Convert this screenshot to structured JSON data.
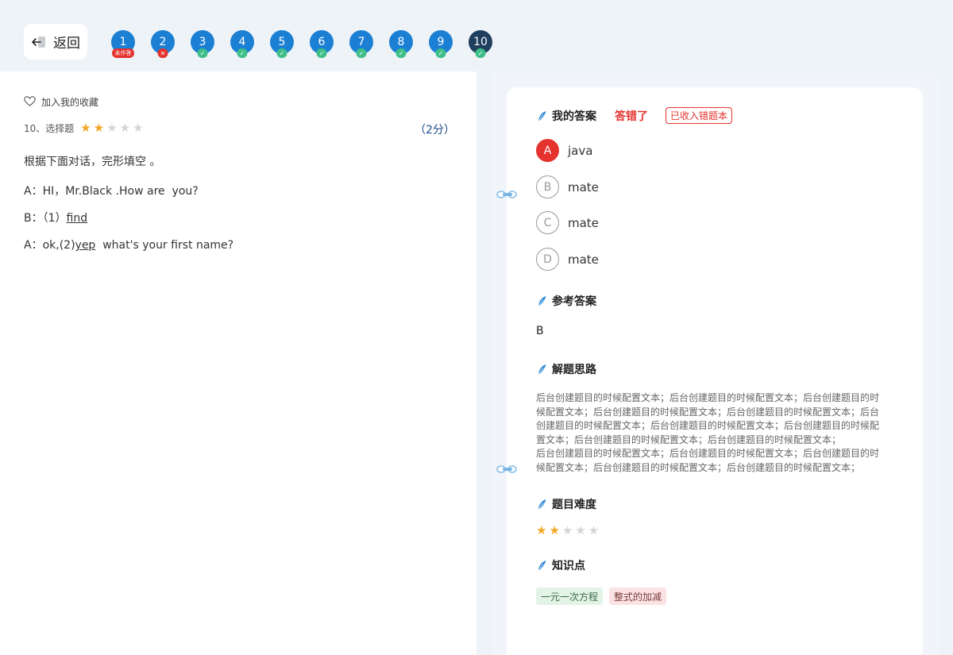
{
  "header": {
    "back_label": "返回",
    "questions": [
      {
        "num": "1",
        "badge": "未作答",
        "status": "unanswered"
      },
      {
        "num": "2",
        "badge": "✕",
        "status": "wrong"
      },
      {
        "num": "3",
        "badge": "✓",
        "status": "right"
      },
      {
        "num": "4",
        "badge": "✓",
        "status": "right"
      },
      {
        "num": "5",
        "badge": "✓",
        "status": "right"
      },
      {
        "num": "6",
        "badge": "✓",
        "status": "right"
      },
      {
        "num": "7",
        "badge": "✓",
        "status": "right"
      },
      {
        "num": "8",
        "badge": "✓",
        "status": "right"
      },
      {
        "num": "9",
        "badge": "✓",
        "status": "right"
      },
      {
        "num": "10",
        "badge": "✓",
        "status": "current"
      }
    ]
  },
  "question": {
    "favorite_label": "加入我的收藏",
    "type_label": "10、选择题",
    "difficulty_stars": 2,
    "max_stars": 5,
    "score": "（2分）",
    "prompt": "根据下面对话，完形填空 。",
    "line_a1": "A：HI，Mr.Black .How are  you?",
    "line_b_prefix": "B：（1）",
    "line_b_blank": "find",
    "line_a2_prefix": "A：ok,(2)",
    "line_a2_blank": "yep",
    "line_a2_suffix": "  what's your first name?"
  },
  "answer_panel": {
    "my_answer_title": "我的答案",
    "result_text": "答错了",
    "wrong_book_tag": "已收入错题本",
    "options": [
      {
        "letter": "A",
        "text": "java",
        "selected": true
      },
      {
        "letter": "B",
        "text": "mate",
        "selected": false
      },
      {
        "letter": "C",
        "text": "mate",
        "selected": false
      },
      {
        "letter": "D",
        "text": "mate",
        "selected": false
      }
    ],
    "reference_title": "参考答案",
    "reference_answer": "B",
    "analysis_title": "解题思路",
    "analysis_lines": [
      "后台创建题目的时候配置文本；后台创建题目的时候配置文本；后台创建题目的时",
      "候配置文本；后台创建题目的时候配置文本；后台创建题目的时候配置文本；后台",
      "创建题目的时候配置文本；后台创建题目的时候配置文本；后台创建题目的时候配",
      "置文本；后台创建题目的时候配置文本；后台创建题目的时候配置文本；",
      "后台创建题目的时候配置文本；后台创建题目的时候配置文本；后台创建题目的时",
      "候配置文本；后台创建题目的时候配置文本；后台创建题目的时候配置文本；"
    ],
    "difficulty_title": "题目难度",
    "difficulty_stars": 2,
    "knowledge_title": "知识点",
    "knowledge_tags": [
      "一元一次方程",
      "整式的加减"
    ]
  },
  "colors": {
    "accent_blue": "#1b7fd4",
    "current_question": "#1f3f5f",
    "wrong_red": "#e5322d",
    "right_green": "#3fbf87",
    "star_on": "#f5a623"
  }
}
